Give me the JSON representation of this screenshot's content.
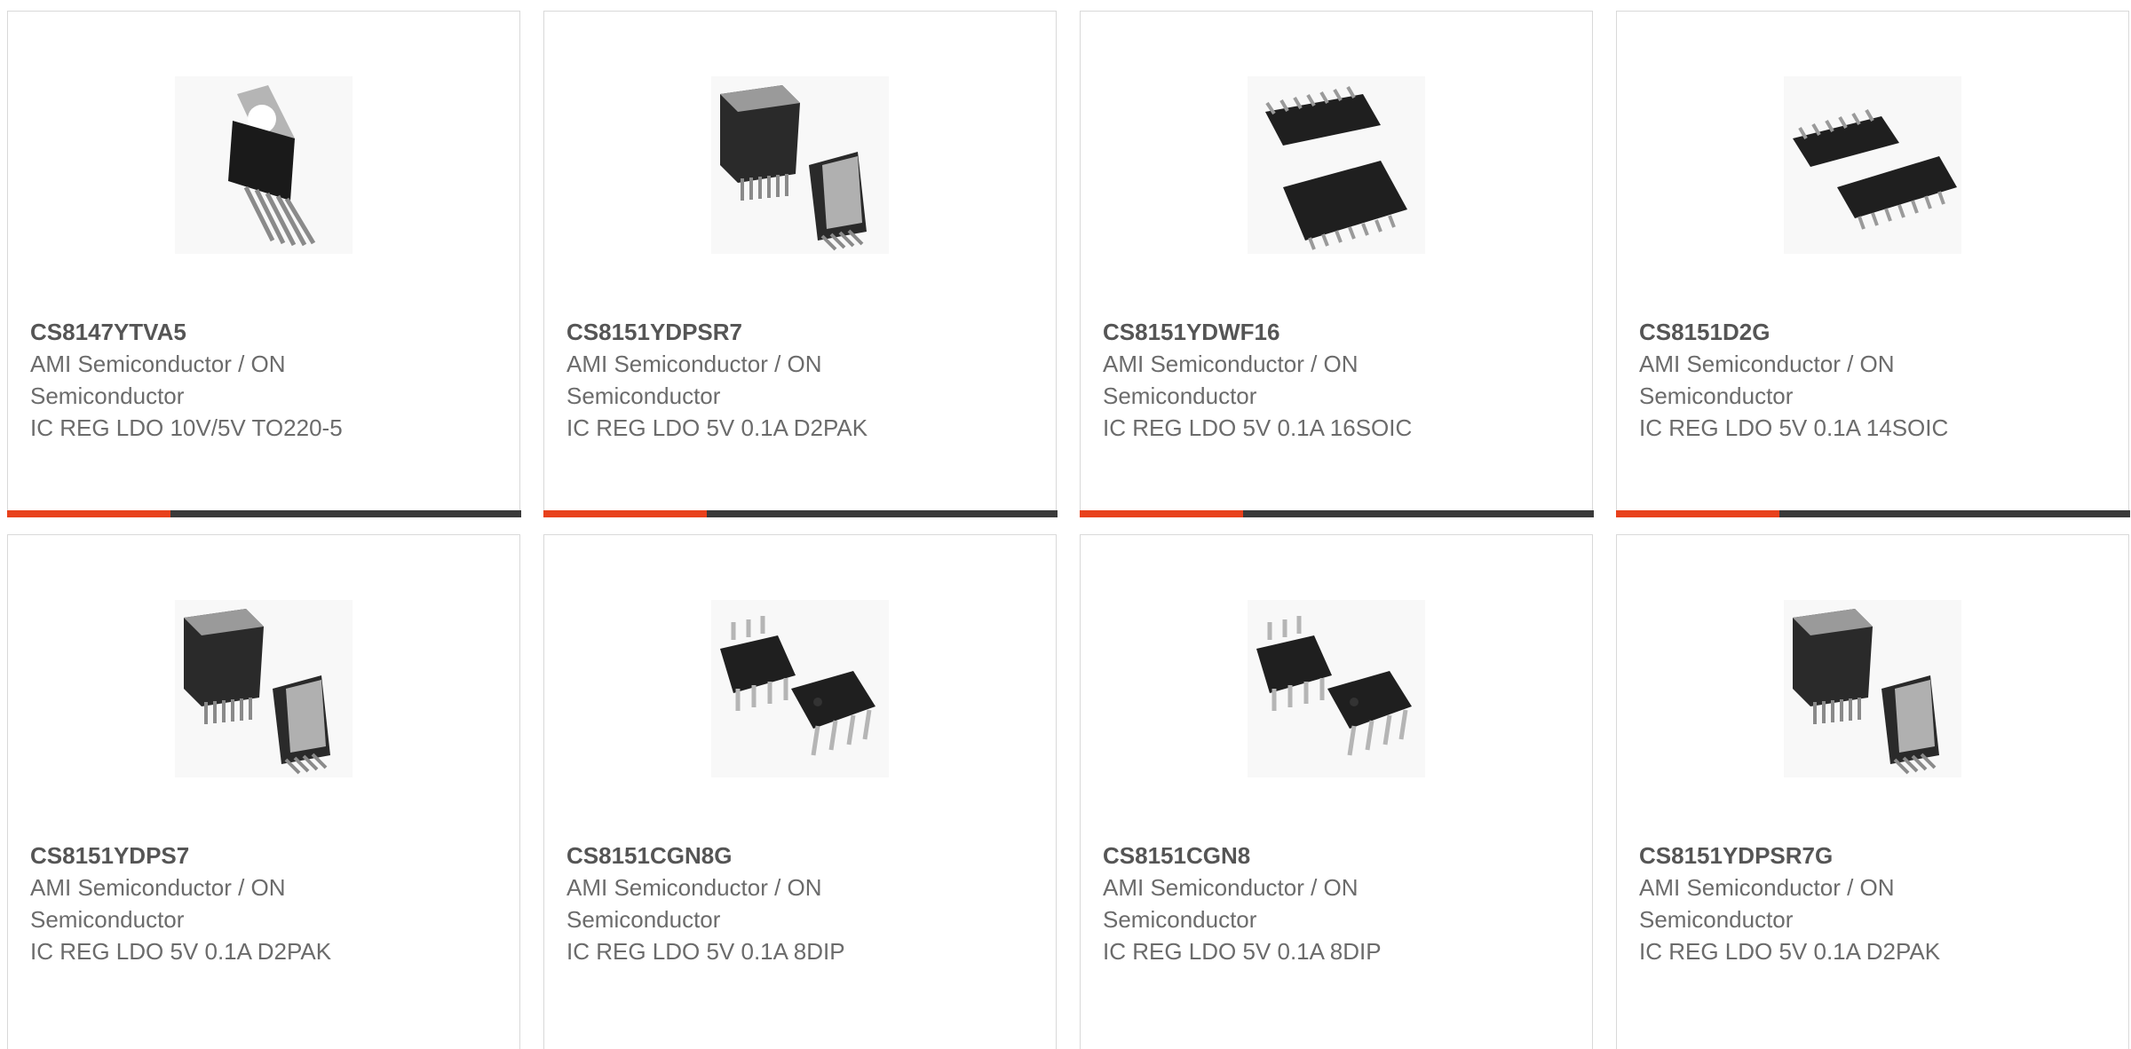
{
  "products": [
    {
      "part": "CS8147YTVA5",
      "maker_line1": "AMI Semiconductor / ON",
      "maker_line2": "Semiconductor",
      "desc": "IC REG LDO 10V/5V TO220-5",
      "image": "to220-5-package"
    },
    {
      "part": "CS8151YDPSR7",
      "maker_line1": "AMI Semiconductor / ON",
      "maker_line2": "Semiconductor",
      "desc": "IC REG LDO 5V 0.1A D2PAK",
      "image": "d2pak-package"
    },
    {
      "part": "CS8151YDWF16",
      "maker_line1": "AMI Semiconductor / ON",
      "maker_line2": "Semiconductor",
      "desc": "IC REG LDO 5V 0.1A 16SOIC",
      "image": "soic16-package"
    },
    {
      "part": "CS8151D2G",
      "maker_line1": "AMI Semiconductor / ON",
      "maker_line2": "Semiconductor",
      "desc": "IC REG LDO 5V 0.1A 14SOIC",
      "image": "soic14-package"
    },
    {
      "part": "CS8151YDPS7",
      "maker_line1": "AMI Semiconductor / ON",
      "maker_line2": "Semiconductor",
      "desc": "IC REG LDO 5V 0.1A D2PAK",
      "image": "d2pak-package"
    },
    {
      "part": "CS8151CGN8G",
      "maker_line1": "AMI Semiconductor / ON",
      "maker_line2": "Semiconductor",
      "desc": "IC REG LDO 5V 0.1A 8DIP",
      "image": "dip8-package"
    },
    {
      "part": "CS8151CGN8",
      "maker_line1": "AMI Semiconductor / ON",
      "maker_line2": "Semiconductor",
      "desc": "IC REG LDO 5V 0.1A 8DIP",
      "image": "dip8-package"
    },
    {
      "part": "CS8151YDPSR7G",
      "maker_line1": "AMI Semiconductor / ON",
      "maker_line2": "Semiconductor",
      "desc": "IC REG LDO 5V 0.1A D2PAK",
      "image": "d2pak-package"
    }
  ],
  "colors": {
    "accent": "#e8411c",
    "bar": "#3a3a3a",
    "border": "#d9d9d9",
    "text": "#6b6b6b"
  }
}
